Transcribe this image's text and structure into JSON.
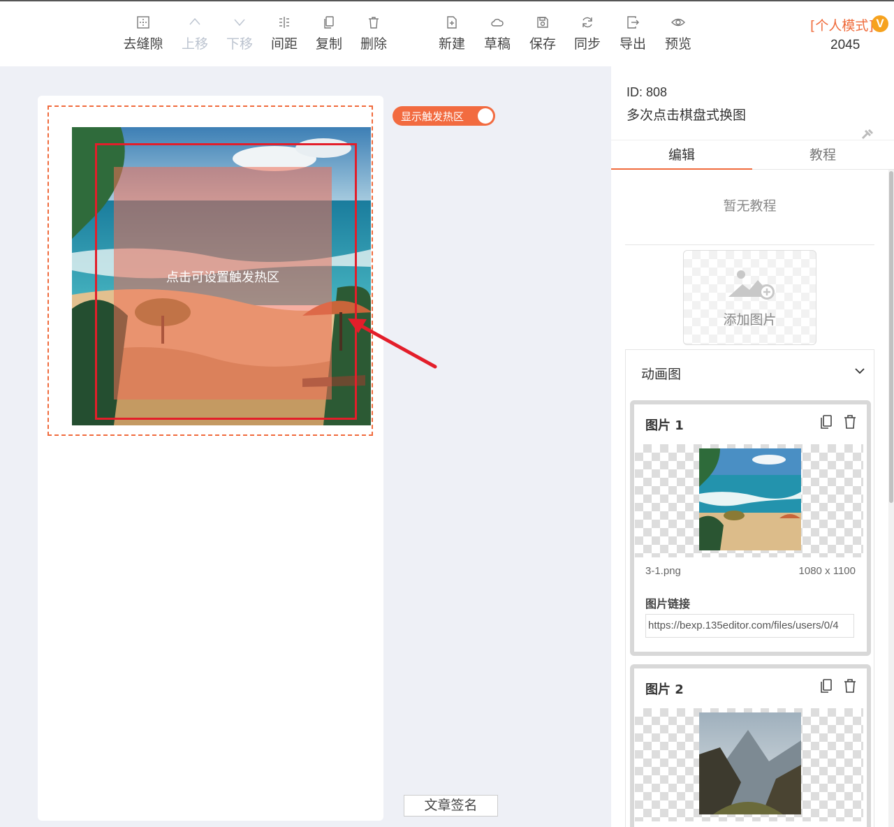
{
  "toolbar": {
    "items": [
      {
        "label": "去缝隙",
        "icon": "gap-icon",
        "enabled": true
      },
      {
        "label": "上移",
        "icon": "chevron-up-icon",
        "enabled": false
      },
      {
        "label": "下移",
        "icon": "chevron-down-icon",
        "enabled": false
      },
      {
        "label": "间距",
        "icon": "spacing-icon",
        "enabled": true
      },
      {
        "label": "复制",
        "icon": "copy-icon",
        "enabled": true
      },
      {
        "label": "删除",
        "icon": "trash-icon",
        "enabled": true
      },
      {
        "label": "新建",
        "icon": "new-file-icon",
        "enabled": true
      },
      {
        "label": "草稿",
        "icon": "cloud-icon",
        "enabled": true
      },
      {
        "label": "保存",
        "icon": "save-icon",
        "enabled": true
      },
      {
        "label": "同步",
        "icon": "sync-icon",
        "enabled": true
      },
      {
        "label": "导出",
        "icon": "export-icon",
        "enabled": true
      },
      {
        "label": "预览",
        "icon": "eye-icon",
        "enabled": true
      }
    ],
    "mode_label": "[个人模式]",
    "vip_badge": "V",
    "count": "2045"
  },
  "canvas": {
    "hotzone_label": "点击可设置触发热区",
    "toggle_label": "显示触发热区",
    "toggle_on": true,
    "signature_button": "文章签名"
  },
  "panel": {
    "id_label": "ID: 808",
    "name": "多次点击棋盘式换图",
    "tabs": [
      {
        "label": "编辑",
        "active": true
      },
      {
        "label": "教程",
        "active": false
      }
    ],
    "no_tutorial": "暂无教程",
    "add_image_label": "添加图片",
    "accordion_title": "动画图",
    "images": [
      {
        "title": "图片 1",
        "filename": "3-1.png",
        "size": "1080 x 1100",
        "link_label": "图片链接",
        "link": "https://bexp.135editor.com/files/users/0/4"
      },
      {
        "title": "图片 2"
      }
    ]
  },
  "colors": {
    "accent": "#f06a3c",
    "highlight_red": "#e31e2a",
    "vip": "#f6a21e"
  }
}
